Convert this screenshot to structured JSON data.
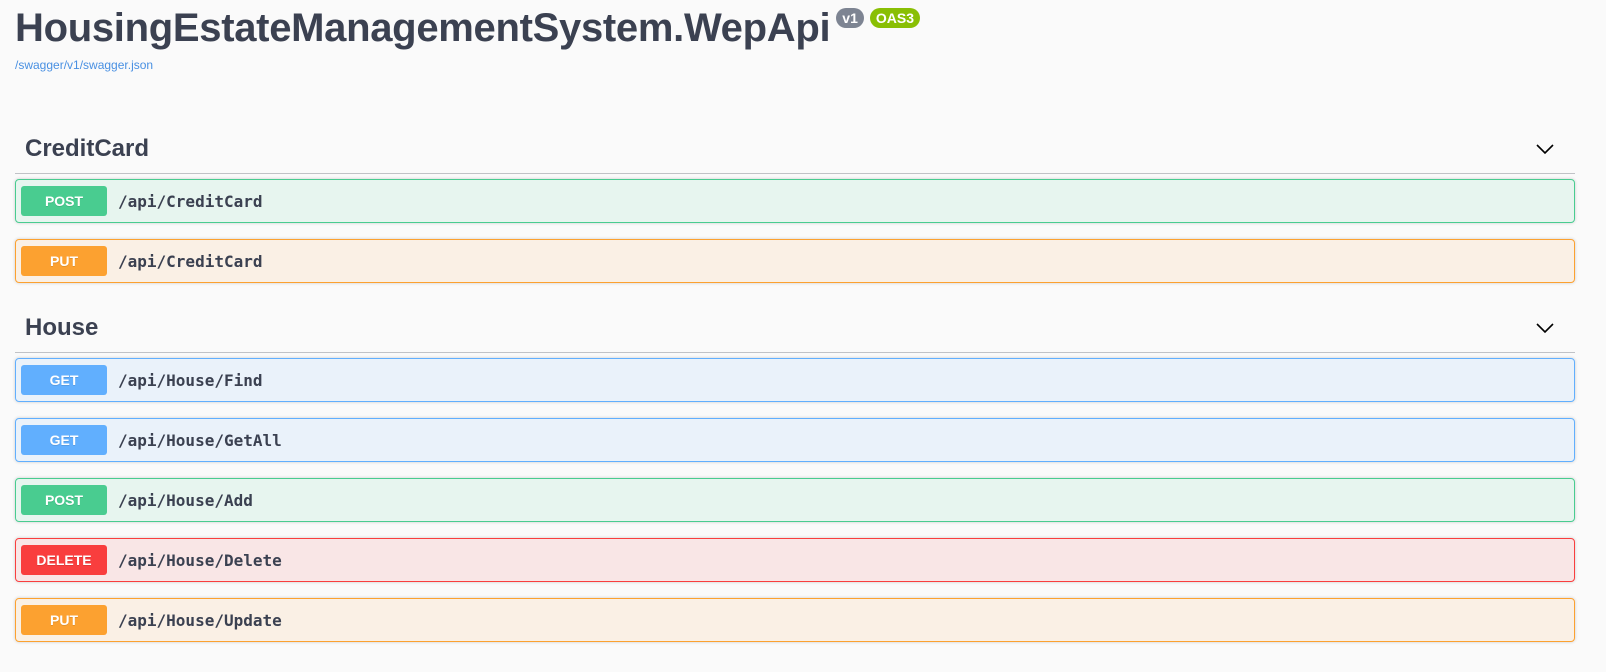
{
  "info": {
    "title": "HousingEstateManagementSystem.WepApi",
    "version_badge": "v1",
    "oas_badge": "OAS3",
    "spec_url": "/swagger/v1/swagger.json"
  },
  "tags": [
    {
      "name": "CreditCard",
      "icon": "chevron-down-icon",
      "operations": [
        {
          "method": "POST",
          "path": "/api/CreditCard"
        },
        {
          "method": "PUT",
          "path": "/api/CreditCard"
        }
      ]
    },
    {
      "name": "House",
      "icon": "chevron-down-icon",
      "operations": [
        {
          "method": "GET",
          "path": "/api/House/Find"
        },
        {
          "method": "GET",
          "path": "/api/House/GetAll"
        },
        {
          "method": "POST",
          "path": "/api/House/Add"
        },
        {
          "method": "DELETE",
          "path": "/api/House/Delete"
        },
        {
          "method": "PUT",
          "path": "/api/House/Update"
        }
      ]
    }
  ],
  "colors": {
    "post": "#49cc90",
    "put": "#fca130",
    "get": "#61affe",
    "delete": "#f93e3e",
    "link": "#4990e2",
    "text": "#3b4151"
  }
}
